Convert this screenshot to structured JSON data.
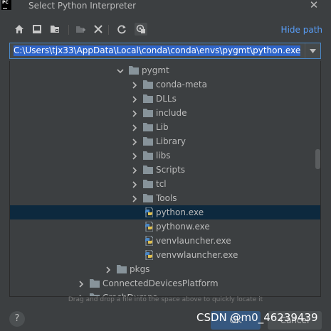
{
  "window": {
    "title": "Select Python Interpreter",
    "logo_text": "PC",
    "close_glyph": "✕"
  },
  "toolbar": {
    "icons": [
      "home-icon",
      "desktop-icon",
      "project-folder-icon",
      "new-folder-icon",
      "delete-icon",
      "refresh-icon",
      "show-hidden-icon"
    ],
    "hide_path_label": "Hide path"
  },
  "path": {
    "value": "C:\\Users\\tjx33\\AppData\\Local\\conda\\conda\\envs\\pygmt\\python.exe"
  },
  "tree": {
    "rows": [
      {
        "label": "pygmt",
        "type": "folder",
        "expanded": true
      },
      {
        "label": "conda-meta",
        "type": "folder",
        "expanded": false
      },
      {
        "label": "DLLs",
        "type": "folder",
        "expanded": false
      },
      {
        "label": "include",
        "type": "folder",
        "expanded": false
      },
      {
        "label": "Lib",
        "type": "folder",
        "expanded": false
      },
      {
        "label": "Library",
        "type": "folder",
        "expanded": false
      },
      {
        "label": "libs",
        "type": "folder",
        "expanded": false
      },
      {
        "label": "Scripts",
        "type": "folder",
        "expanded": false
      },
      {
        "label": "tcl",
        "type": "folder",
        "expanded": false
      },
      {
        "label": "Tools",
        "type": "folder",
        "expanded": false
      },
      {
        "label": "python.exe",
        "type": "file",
        "selected": true
      },
      {
        "label": "pythonw.exe",
        "type": "file"
      },
      {
        "label": "venvlauncher.exe",
        "type": "file"
      },
      {
        "label": "venvwlauncher.exe",
        "type": "file"
      },
      {
        "label": "pkgs",
        "type": "folder",
        "expanded": false
      },
      {
        "label": "ConnectedDevicesPlatform",
        "type": "folder",
        "expanded": false
      },
      {
        "label": "CrashDumps",
        "type": "folder",
        "expanded": false
      }
    ]
  },
  "footer": {
    "hint": "Drag and drop a file into the space above to quickly locate it",
    "help_label": "?",
    "ok_label": "OK",
    "cancel_label": "Cancel",
    "watermark": "CSDN @m0_46239439"
  },
  "colors": {
    "background": "#3c3f41",
    "selection": "#0d293e",
    "link": "#589df6",
    "path_highlight": "#2f65ca",
    "folder": "#87939a",
    "python_file": "#9aa7b0"
  }
}
